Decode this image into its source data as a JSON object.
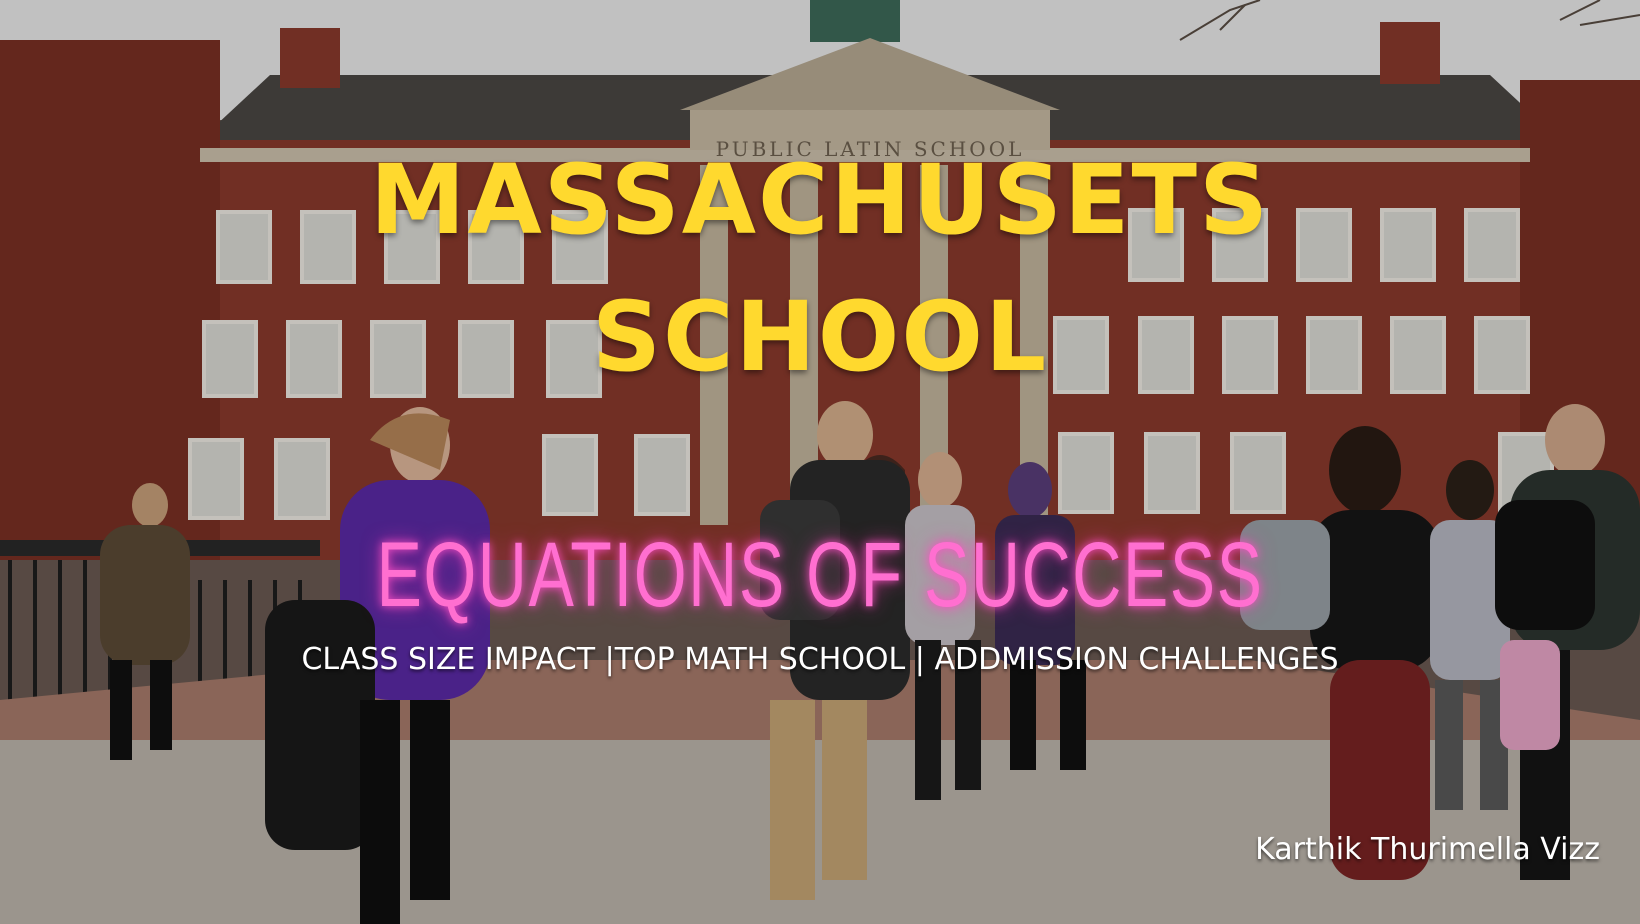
{
  "poster": {
    "title_line1": "MASSACHUSETS",
    "title_line2": "SCHOOL",
    "subtitle": "EQUATIONS OF SUCCESS",
    "tagline": "CLASS SIZE IMPACT |TOP MATH SCHOOL | ADDMISSION CHALLENGES",
    "credit": "Karthik Thurimella Vizz"
  },
  "building_sign": "PUBLIC LATIN SCHOOL",
  "colors": {
    "title": "#ffd92e",
    "subtitle": "#ff6fd0",
    "tagline": "#ffffff",
    "brick": "#8a3a2c",
    "sky": "#ececec"
  }
}
